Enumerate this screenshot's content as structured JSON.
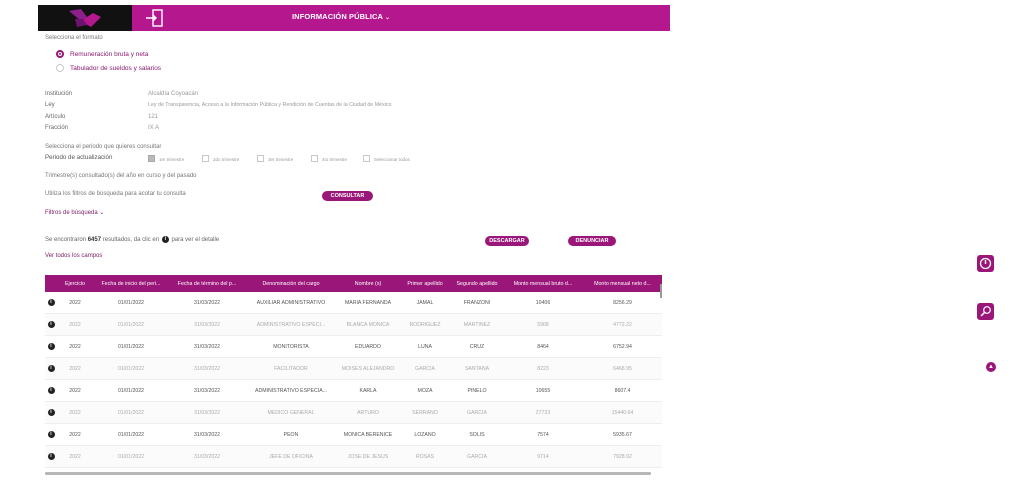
{
  "header": {
    "menu_title": "INFORMACIÓN PÚBLICA",
    "caret": "⌄"
  },
  "format": {
    "prompt": "Selecciona el formato",
    "options": [
      {
        "label": "Remuneración bruta y neta",
        "selected": true
      },
      {
        "label": "Tabulador de sueldos y salarios",
        "selected": false
      }
    ]
  },
  "details": [
    {
      "label": "Institución",
      "value": "Alcaldía Coyoacán"
    },
    {
      "label": "Ley",
      "value": "Ley de Transparencia, Acceso a la Información Pública y Rendición de Cuentas de la Ciudad de México"
    },
    {
      "label": "Artículo",
      "value": "121"
    },
    {
      "label": "Fracción",
      "value": "IX A"
    }
  ],
  "period": {
    "prompt": "Selecciona el periodo que quieres consultar",
    "label": "Periodo de actualización",
    "options": [
      {
        "label": "1er trimestre",
        "checked": true
      },
      {
        "label": "2do trimestre",
        "checked": false
      },
      {
        "label": "3er trimestre",
        "checked": false
      },
      {
        "label": "4to trimestre",
        "checked": false
      },
      {
        "label": "Seleccionar todos",
        "checked": false
      }
    ],
    "note": "Trimestre(s) consultado(s) del año en curso y del pasado"
  },
  "filters_hint": "Utiliza los filtros de búsqueda para acotar tu consulta",
  "consult_button": "CONSULTAR",
  "filters_toggle": "Filtros de búsqueda ⌄",
  "results": {
    "prefix": "Se encontraron",
    "count": "6457",
    "suffix": "resultados, da clic en",
    "suffix2": "para ver el detalle"
  },
  "download_button": "DESCARGAR",
  "report_button": "DENUNCIAR",
  "view_all": "Ver todos los campos",
  "table": {
    "headers": [
      "Ejercicio",
      "Fecha de inicio del peri...",
      "Fecha de término del p...",
      "Denominación del cargo",
      "Nombre (s)",
      "Primer apellido",
      "Segundo apellido",
      "Monto mensual bruto d...",
      "Monto mensual neto d..."
    ],
    "rows": [
      [
        "2022",
        "01/01/2022",
        "31/03/2022",
        "AUXILIAR ADMINISTRATIVO",
        "MARIA FERNANDA",
        "JAMAL",
        "FRANZONI",
        "10406",
        "8256.29"
      ],
      [
        "2022",
        "01/01/2022",
        "31/03/2022",
        "ADMINISTRATIVO ESPECI...",
        "BLANCA MONICA",
        "RODRIGUEZ",
        "MARTINEZ",
        "5908",
        "4772.22"
      ],
      [
        "2022",
        "01/01/2022",
        "31/03/2022",
        "MONITORISTA",
        "EDUARDO",
        "LUNA",
        "CRUZ",
        "8464",
        "6752.94"
      ],
      [
        "2022",
        "01/01/2022",
        "31/03/2022",
        "FACILITADOR",
        "MOISES ALEJANDRO",
        "GARCIA",
        "SANTANA",
        "8223",
        "6468.95"
      ],
      [
        "2022",
        "01/01/2022",
        "31/03/2022",
        "ADMINISTRATIVO ESPECIA...",
        "KARLA",
        "MOZA",
        "PINELO",
        "10655",
        "8607.4"
      ],
      [
        "2022",
        "01/01/2022",
        "31/03/2022",
        "MEDICO GENERAL",
        "ARTURO",
        "SERRANO",
        "GARCIA",
        "27733",
        "15440.64"
      ],
      [
        "2022",
        "01/01/2022",
        "31/03/2022",
        "PEON",
        "MONICA BERENICE",
        "LOZANO",
        "SOLIS",
        "7574",
        "5935.67"
      ],
      [
        "2022",
        "01/01/2022",
        "31/03/2022",
        "JEFE DE OFICINA",
        "JOSE DE JESUS",
        "ROSAS",
        "GARCIA",
        "9714",
        "7928.92"
      ]
    ]
  },
  "colors": {
    "brand": "#b5178f",
    "accent": "#9b1679"
  }
}
